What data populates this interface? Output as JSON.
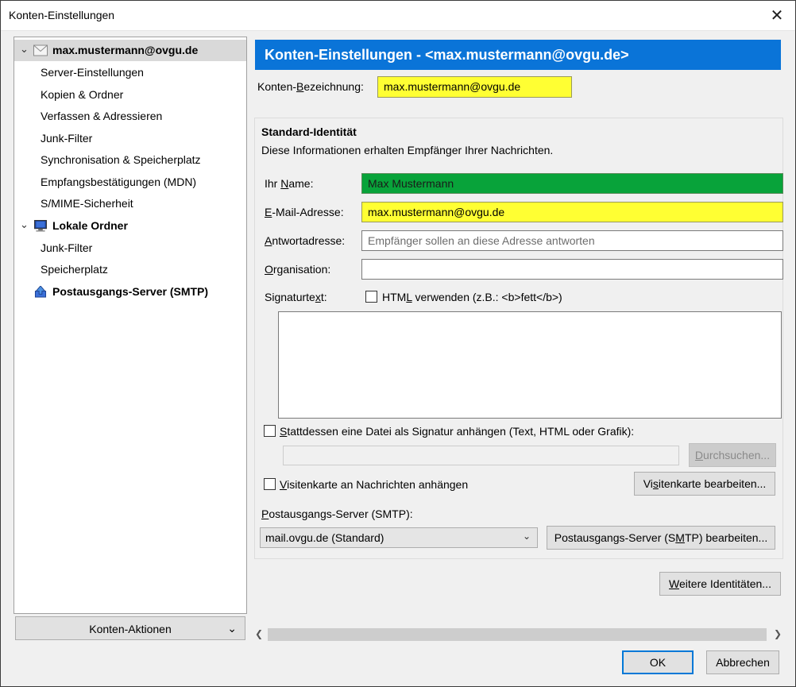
{
  "window": {
    "title": "Konten-Einstellungen",
    "close_glyph": "✕"
  },
  "tree": {
    "account": "max.mustermann@ovgu.de",
    "account_children": [
      "Server-Einstellungen",
      "Kopien & Ordner",
      "Verfassen & Adressieren",
      "Junk-Filter",
      "Synchronisation & Speicherplatz",
      "Empfangsbestätigungen (MDN)",
      "S/MIME-Sicherheit"
    ],
    "local": "Lokale Ordner",
    "local_children": [
      "Junk-Filter",
      "Speicherplatz"
    ],
    "smtp": "Postausgangs-Server (SMTP)"
  },
  "account_actions": "Konten-Aktionen",
  "header": "Konten-Einstellungen - <max.mustermann@ovgu.de>",
  "account_name": {
    "label_a": "Konten-",
    "label_u": "B",
    "label_b": "ezeichnung:",
    "value": "max.mustermann@ovgu.de"
  },
  "identity": {
    "title": "Standard-Identität",
    "description": "Diese Informationen erhalten Empfänger Ihrer Nachrichten.",
    "name": {
      "label_a": "Ihr ",
      "label_u": "N",
      "label_b": "ame:",
      "value": "Max Mustermann"
    },
    "email": {
      "label_u": "E",
      "label_b": "-Mail-Adresse:",
      "value": "max.mustermann@ovgu.de"
    },
    "reply": {
      "label_u": "A",
      "label_b": "ntwortadresse:",
      "placeholder": "Empfänger sollen an diese Adresse antworten"
    },
    "org": {
      "label_u": "O",
      "label_b": "rganisation:",
      "value": ""
    },
    "signature": {
      "label_a": "Signaturte",
      "label_u": "x",
      "label_b": "t:",
      "html_a": "HTM",
      "html_u": "L",
      "html_b": " verwenden (z.B.: <b>fett</b>)"
    },
    "attach_file": {
      "label_u": "S",
      "label_b": "tattdessen eine Datei als Signatur anhängen (Text, HTML oder Grafik):",
      "checked": false
    },
    "browse": {
      "label_u": "D",
      "label_b": "urchsuchen..."
    },
    "vcard": {
      "label_u": "V",
      "label_b": "isitenkarte an Nachrichten anhängen",
      "checked": false
    },
    "vcard_edit": {
      "label_a": "Vi",
      "label_u": "s",
      "label_b": "itenkarte bearbeiten..."
    },
    "smtp_label": {
      "label_u": "P",
      "label_b": "ostausgangs-Server (SMTP):"
    },
    "smtp_select": "mail.ovgu.de (Standard)",
    "smtp_edit": {
      "label_a": "Postausgangs-Server (S",
      "label_u": "M",
      "label_b": "TP) bearbeiten..."
    }
  },
  "more_identities": {
    "label_u": "W",
    "label_b": "eitere Identitäten..."
  },
  "ok": "OK",
  "cancel": "Abbrechen"
}
